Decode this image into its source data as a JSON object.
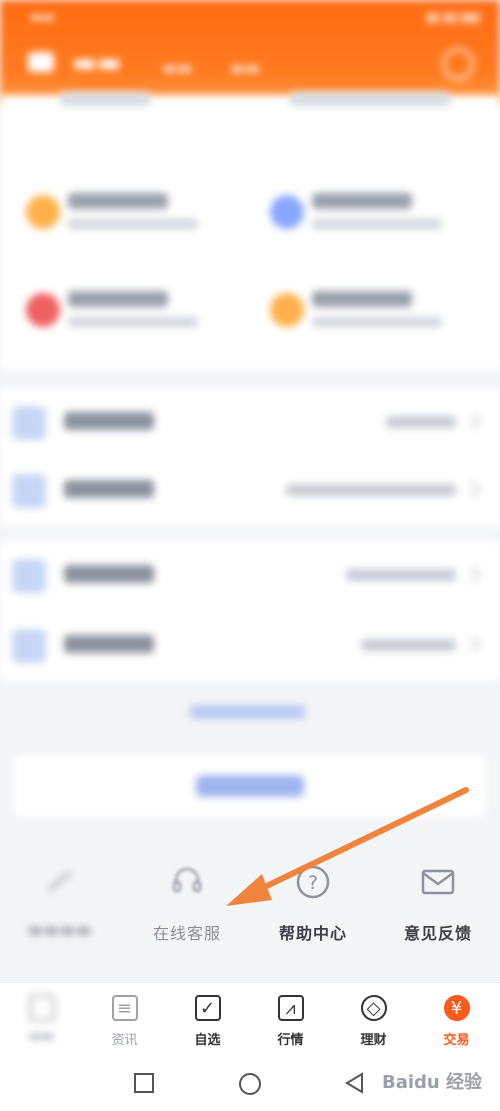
{
  "services": {
    "items": [
      {
        "label": "在线客服",
        "icon": "headset-icon"
      },
      {
        "label": "帮助中心",
        "icon": "question-icon"
      },
      {
        "label": "意见反馈",
        "icon": "mail-icon"
      }
    ]
  },
  "tabbar": {
    "items": [
      {
        "label": "资讯",
        "icon": "news-icon"
      },
      {
        "label": "自选",
        "icon": "checkbox-icon"
      },
      {
        "label": "行情",
        "icon": "chart-icon"
      },
      {
        "label": "理财",
        "icon": "diamond-icon"
      },
      {
        "label": "交易",
        "icon": "yuan-icon"
      }
    ]
  },
  "watermark": {
    "text": "Baidu 经验"
  },
  "colors": {
    "brand": "#ff6a12",
    "accent_blue": "#9fb5ef",
    "arrow": "#f0843c"
  }
}
